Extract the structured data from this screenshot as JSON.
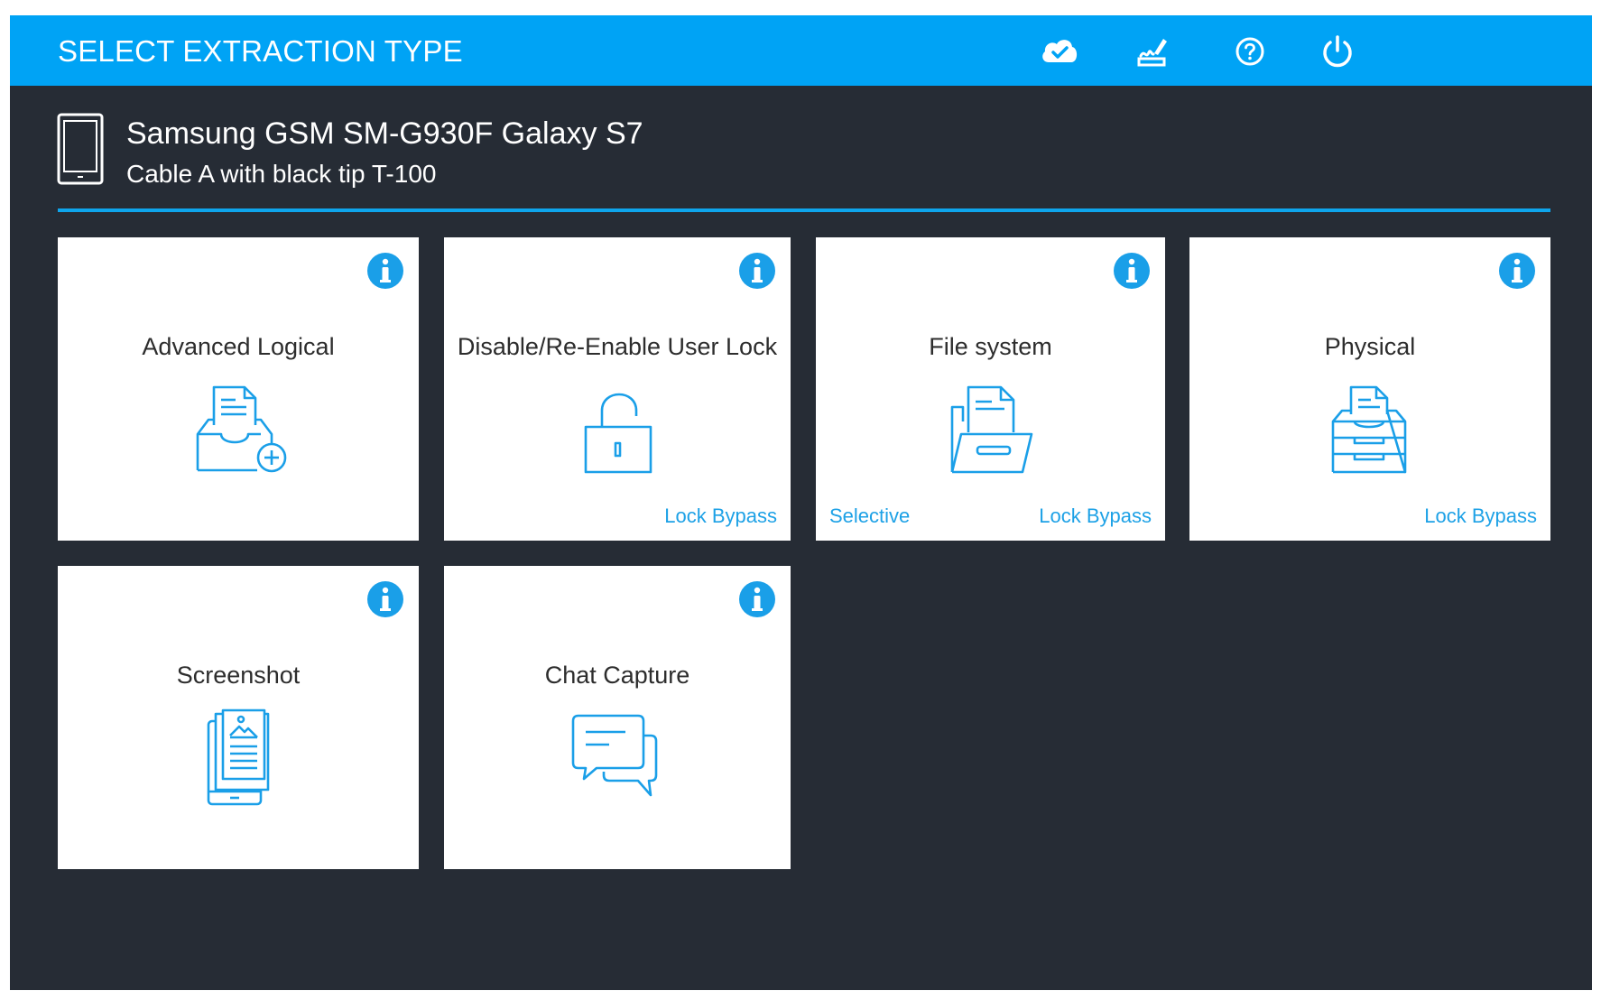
{
  "header": {
    "title": "SELECT EXTRACTION TYPE",
    "icons": [
      "cloud-check-icon",
      "signature-icon",
      "help-icon",
      "power-icon"
    ]
  },
  "device": {
    "name": "Samsung GSM SM-G930F Galaxy S7",
    "cable": "Cable A with black tip T-100",
    "icon": "phone-icon"
  },
  "tiles": [
    {
      "label": "Advanced Logical",
      "icon": "inbox-add-icon",
      "links": []
    },
    {
      "label": "Disable/Re-Enable User Lock",
      "icon": "unlock-icon",
      "links": [
        "Lock Bypass"
      ]
    },
    {
      "label": "File system",
      "icon": "folder-document-icon",
      "links": [
        "Selective",
        "Lock Bypass"
      ]
    },
    {
      "label": "Physical",
      "icon": "drawer-cabinet-icon",
      "links": [
        "Lock Bypass"
      ]
    },
    {
      "label": "Screenshot",
      "icon": "device-image-icon",
      "links": []
    },
    {
      "label": "Chat Capture",
      "icon": "chat-bubbles-icon",
      "links": []
    }
  ],
  "colors": {
    "accent": "#00a3f5",
    "background": "#262c35",
    "tile": "#ffffff",
    "link": "#1da1e6",
    "icon_stroke": "#1a9fe8"
  }
}
